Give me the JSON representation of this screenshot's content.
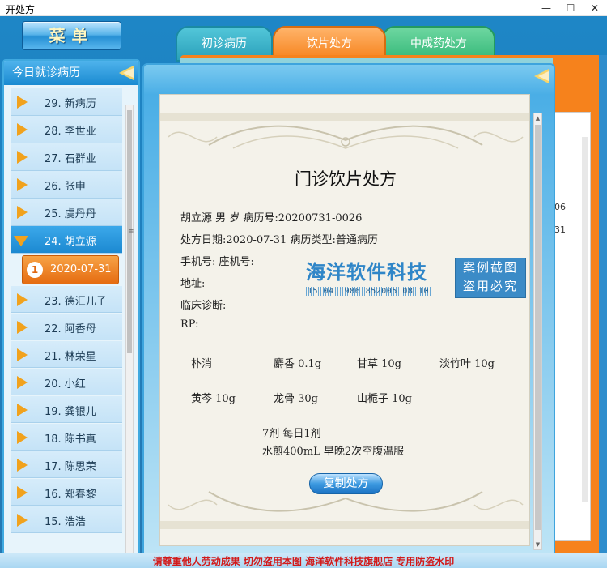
{
  "window": {
    "title": "开处方",
    "minimize_glyph": "—",
    "maximize_glyph": "☐",
    "close_glyph": "✕"
  },
  "menu": {
    "label": "菜单"
  },
  "left_panel": {
    "title": "今日就诊病历",
    "items": [
      {
        "label": "29.  新病历"
      },
      {
        "label": "28.  李世业"
      },
      {
        "label": "27.  石群业"
      },
      {
        "label": "26.  张申"
      },
      {
        "label": "25.  虞丹丹"
      },
      {
        "label": "24.  胡立源",
        "selected": true
      },
      {
        "label": "23.  德汇儿子"
      },
      {
        "label": "22.  阿香母"
      },
      {
        "label": "21.  林荣星"
      },
      {
        "label": "20.  小红"
      },
      {
        "label": "19.  龚银儿"
      },
      {
        "label": "18.  陈书真"
      },
      {
        "label": "17.  陈思荣"
      },
      {
        "label": "16.  郑春黎"
      },
      {
        "label": "15.  浩浩"
      }
    ],
    "sub_item": {
      "number": "1",
      "date": "2020-07-31"
    }
  },
  "tabs": [
    {
      "label": "初诊病历"
    },
    {
      "label": "饮片处方"
    },
    {
      "label": "中成药处方"
    }
  ],
  "background_fragments": {
    "a": "06",
    "b": "31"
  },
  "prescription": {
    "title": "门诊饮片处方",
    "line1": "胡立源   男   岁    病历号:20200731-0026",
    "line2": "处方日期:2020-07-31    病历类型:普通病历",
    "line3": "手机号:   座机号:",
    "line4": "地址:",
    "line5": "临床诊断:",
    "line6": "RP:",
    "drugs": [
      "朴消",
      "麝香 0.1g",
      "甘草 10g",
      "淡竹叶 10g",
      "黄芩 10g",
      "龙骨 30g",
      "山栀子 10g"
    ],
    "dosage": "7剂   每日1剂",
    "usage": "水煎400mL 早晚2次空腹温服",
    "copy_button": "复制处方"
  },
  "watermark": {
    "brand": "海洋软件科技",
    "code": "15 04 1986 852005 08 10",
    "right_line1": "案例截图",
    "right_line2": "盗用必究"
  },
  "footer": {
    "text": "请尊重他人劳动成果   切勿盗用本图   海洋软件科技旗舰店   专用防盗水印"
  },
  "colors": {
    "app_blue": "#1f7fbd",
    "tab_orange": "#f6821c",
    "tab_teal": "#2aa1ba",
    "tab_green": "#35b879",
    "arrow_orange": "#f1a21d",
    "footer_red": "#d21a1a"
  }
}
